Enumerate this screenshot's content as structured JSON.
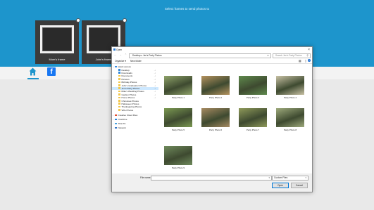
{
  "app": {
    "title": "Select frames to send photos to",
    "frames": [
      {
        "name": "Mom's frame"
      },
      {
        "name": "John's frame"
      }
    ]
  },
  "dialog": {
    "title": "Open",
    "breadcrumb": "Desktop ▸ Jen's Party Photos",
    "search_placeholder": "Search Jen's Party Photos",
    "toolbar": {
      "organize": "Organize ▾",
      "new_folder": "New folder"
    },
    "nav": [
      {
        "label": "Quick access",
        "icon": "star-icon",
        "kind": "header"
      },
      {
        "label": "Desktop",
        "icon": "desktop-icon",
        "pinned": true
      },
      {
        "label": "Downloads",
        "icon": "downloads-icon",
        "pinned": true
      },
      {
        "label": "Documents",
        "icon": "documents-icon",
        "pinned": true
      },
      {
        "label": "Pictures",
        "icon": "pictures-icon",
        "pinned": true
      },
      {
        "label": "Birthday Photos",
        "icon": "folder-icon",
        "pinned": true
      },
      {
        "label": "John's Graduation Photos",
        "icon": "folder-icon",
        "pinned": true
      },
      {
        "label": "Jen's Party Photos",
        "icon": "folder-icon",
        "pinned": true,
        "selected": true
      },
      {
        "label": "Mike's Wedding Photos",
        "icon": "folder-icon",
        "pinned": true
      },
      {
        "label": "Garden Photos",
        "icon": "folder-icon",
        "pinned": true
      },
      {
        "label": "Home Photos",
        "icon": "folder-icon",
        "pinned": true
      },
      {
        "label": "Christmas Photos",
        "icon": "folder-icon"
      },
      {
        "label": "Halloween Photos",
        "icon": "folder-icon"
      },
      {
        "label": "Thanksgiving Photos",
        "icon": "folder-icon"
      },
      {
        "label": "Wife Photos",
        "icon": "folder-icon"
      },
      {
        "label": "Creative Cloud Files",
        "icon": "cloud-icon",
        "kind": "root"
      },
      {
        "label": "OneDrive",
        "icon": "onedrive-icon",
        "kind": "root"
      },
      {
        "label": "This PC",
        "icon": "pc-icon",
        "kind": "root"
      },
      {
        "label": "Network",
        "icon": "network-icon",
        "kind": "root"
      }
    ],
    "files": [
      {
        "name": "Party Photo 1",
        "color": "#8fa36a"
      },
      {
        "name": "Party Photo 2",
        "color": "#b5935f"
      },
      {
        "name": "Party Photo 3",
        "color": "#5f8a4d"
      },
      {
        "name": "Party Photo 4",
        "color": "#c9c2a5"
      },
      {
        "name": "Party Photo 5",
        "color": "#7c9a52"
      },
      {
        "name": "Party Photo 6",
        "color": "#a68a61"
      },
      {
        "name": "Party Photo 7",
        "color": "#8f9a5a"
      },
      {
        "name": "Party Photo 8",
        "color": "#9eaa7c"
      },
      {
        "name": "Party Photo 9",
        "color": "#6f8a5c"
      }
    ],
    "footer": {
      "file_name_label": "File name:",
      "file_name_value": "",
      "filter": "Custom Files",
      "open": "Open",
      "cancel": "Cancel"
    }
  },
  "colors": {
    "accent": "#1d95cc",
    "facebook": "#1877f2"
  }
}
